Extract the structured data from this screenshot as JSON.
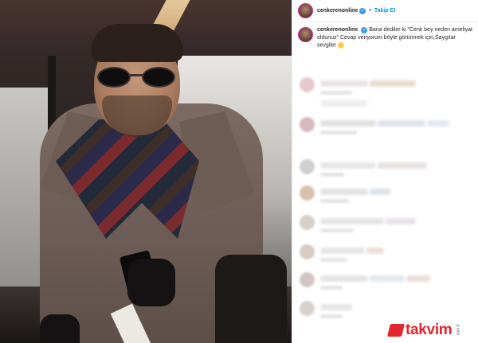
{
  "header": {
    "username": "cenkerenonline",
    "separator": "•",
    "follow_label": "Takip Et"
  },
  "caption": {
    "username": "cenkerenonline",
    "text": "Bana dediler ki \"Cenk bey neden ameliyat oldunuz\" Cevap veriyorum böyle görünmek için,Saygılar sevgiler"
  },
  "icons": {
    "verified": "verified-badge-icon",
    "emoji": "smiling-face-emoji-icon"
  },
  "watermark": {
    "text": "takvim",
    "tld": ".com.tr"
  },
  "colors": {
    "accent": "#0095f6",
    "verified": "#3897f0",
    "watermark": "#e3262b"
  }
}
